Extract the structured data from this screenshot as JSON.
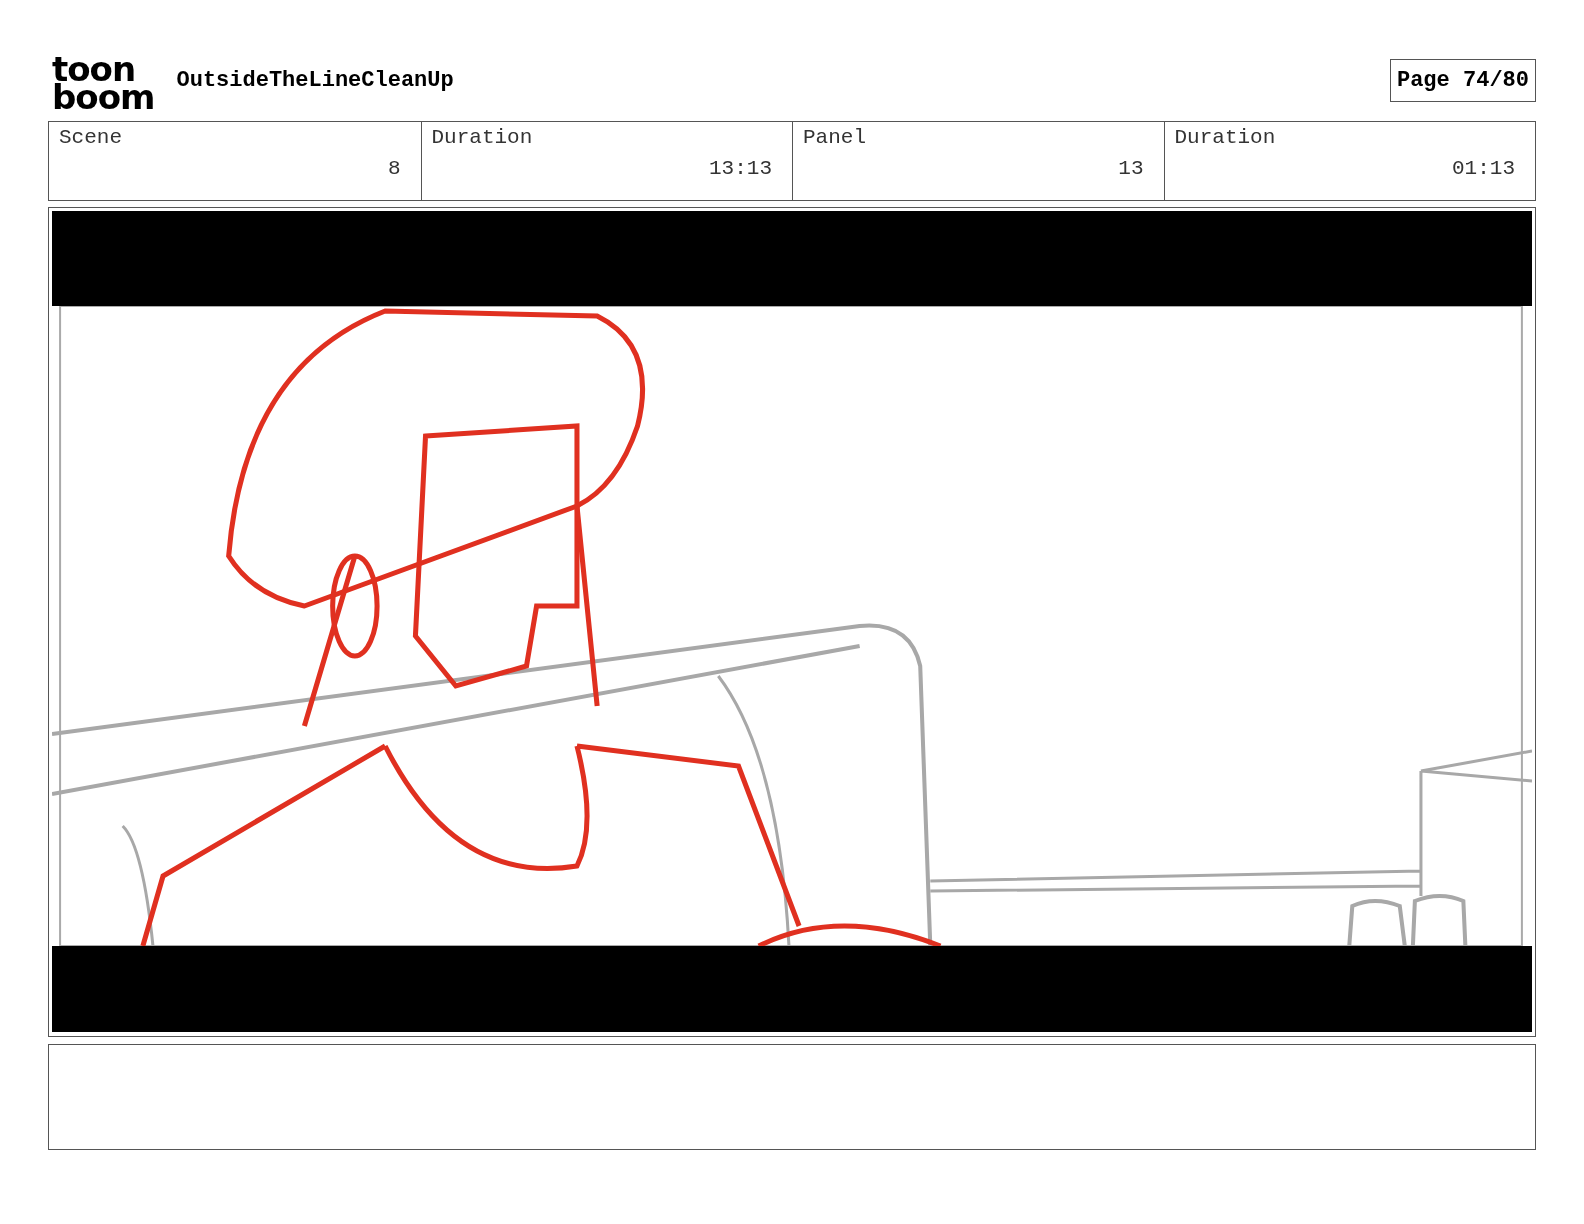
{
  "header": {
    "logo": [
      "toon",
      "boom"
    ],
    "project_title": "OutsideTheLineCleanUp",
    "page": "Page 74/80"
  },
  "info": [
    {
      "label": "Scene",
      "value": "8"
    },
    {
      "label": "Duration",
      "value": "13:13"
    },
    {
      "label": "Panel",
      "value": "13"
    },
    {
      "label": "Duration",
      "value": "01:13"
    }
  ]
}
